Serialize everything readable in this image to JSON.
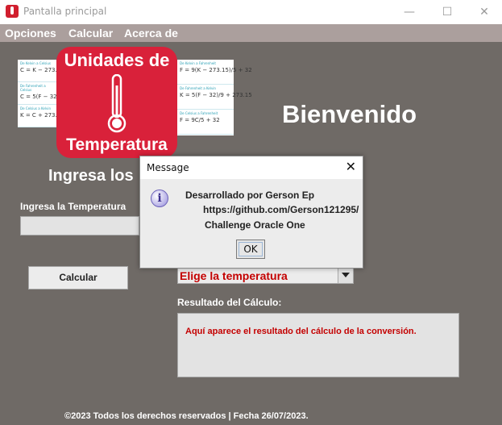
{
  "window": {
    "title": "Pantalla principal"
  },
  "menu": {
    "items": [
      "Opciones",
      "Calcular",
      "Acerca de"
    ]
  },
  "logo": {
    "line1": "Unidades de",
    "line2": "Temperatura"
  },
  "formulas_left": [
    {
      "head": "De Kelvin a Celsius",
      "formula": "C = K − 273.15"
    },
    {
      "head": "De Fahrenheit a Celsius",
      "formula": "C = 5(F − 32) / 9"
    },
    {
      "head": "De Celsius a Kelvin",
      "formula": "K = C + 273.15"
    }
  ],
  "formulas_right": [
    {
      "head": "De Kelvin a Fahrenheit",
      "formula": "F = 9(K − 273.15)/5 + 32"
    },
    {
      "head": "De Fahrenheit a Kelvin",
      "formula": "K = 5(F − 32)/9 + 273.15"
    },
    {
      "head": "De Celsius a Fahrenheit",
      "formula": "F = 9C/5 + 32"
    }
  ],
  "main": {
    "welcome": "Bienvenido",
    "ingresa_heading": "Ingresa los",
    "temperature_label": "Ingresa la Temperatura",
    "temperature_value": "",
    "calculate_button": "Calcular",
    "combo_selected": "Elige la temperatura",
    "result_label": "Resultado del Cálculo:",
    "result_text": "Aquí aparece el resultado del cálculo de la conversión.",
    "footer": "©2023 Todos los derechos reservados | Fecha 26/07/2023."
  },
  "dialog": {
    "title": "Message",
    "close": "✕",
    "lines": [
      "Desarrollado por Gerson Ep",
      "https://github.com/Gerson121295/",
      "Challenge Oracle One"
    ],
    "ok_label": "OK"
  },
  "icons": {
    "app": "thermometer-app-icon",
    "minimize": "minimize-icon",
    "maximize": "maximize-icon",
    "close": "close-icon",
    "info": "info-icon",
    "dropdown": "chevron-down-icon"
  },
  "colors": {
    "background": "#6f6a66",
    "menubar": "#ab9f9d",
    "accent_red": "#c40000",
    "logo_red": "#d9213a"
  }
}
